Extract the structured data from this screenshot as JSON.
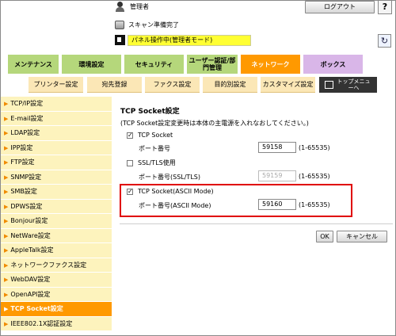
{
  "header": {
    "user_label": "管理者",
    "logout_label": "ログアウト",
    "help_glyph": "?",
    "scan_status": "スキャン準備完了",
    "panel_status": "パネル操作中(管理者モード)",
    "refresh_glyph": "↻"
  },
  "tabs": [
    "メンテナンス",
    "環境設定",
    "セキュリティ",
    "ユーザー認証/部門管理",
    "ネットワーク",
    "ボックス"
  ],
  "subtabs": [
    "プリンター設定",
    "宛先登録",
    "ファクス設定",
    "目的別設定",
    "カスタマイズ設定",
    "トップメニューへ"
  ],
  "sidebar": {
    "items": [
      "TCP/IP設定",
      "E-mail設定",
      "LDAP設定",
      "IPP設定",
      "FTP設定",
      "SNMP設定",
      "SMB設定",
      "DPWS設定",
      "Bonjour設定",
      "NetWare設定",
      "AppleTalk設定",
      "ネットワークファクス設定",
      "WebDAV設定",
      "OpenAPI設定",
      "TCP Socket設定",
      "IEEE802.1X認証設定"
    ],
    "active_index": 14
  },
  "content": {
    "title": "TCP Socket設定",
    "note": "(TCP Socket設定変更時は本体の主電源を入れなおしてください。)",
    "tcp_socket": {
      "label": "TCP Socket",
      "checked": true,
      "port_label": "ポート番号",
      "port": "59158",
      "range": "(1-65535)"
    },
    "ssl": {
      "label": "SSL/TLS使用",
      "checked": false,
      "port_label": "ポート番号(SSL/TLS)",
      "port": "59159",
      "range": "(1-65535)"
    },
    "ascii": {
      "label": "TCP Socket(ASCII Mode)",
      "checked": true,
      "port_label": "ポート番号(ASCII Mode)",
      "port": "59160",
      "range": "(1-65535)"
    },
    "ok_label": "OK",
    "cancel_label": "キャンセル",
    "check_glyph": "✓"
  },
  "colors": {
    "accent_orange": "#ff9900",
    "highlight_red": "#e00000",
    "status_yellow": "#ffff33"
  }
}
